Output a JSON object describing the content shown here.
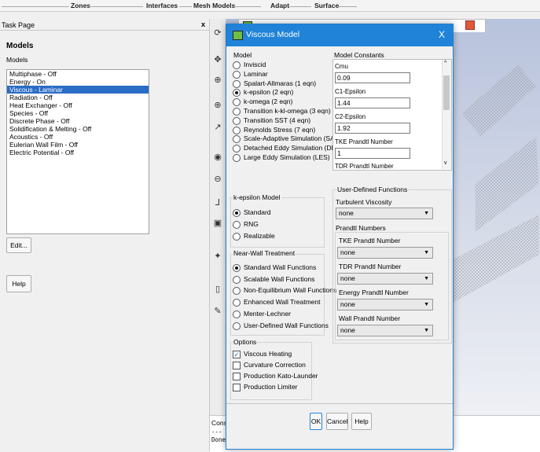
{
  "ribbon": {
    "zones": "Zones",
    "interfaces": "Interfaces",
    "mesh_models": "Mesh Models",
    "adapt": "Adapt",
    "surface": "Surface"
  },
  "task_page": {
    "header": "Task Page",
    "close": "x",
    "title": "Models",
    "subtitle": "Models",
    "models": [
      "Multiphase - Off",
      "Energy - On",
      "Viscous - Laminar",
      "Radiation - Off",
      "Heat Exchanger - Off",
      "Species - Off",
      "Discrete Phase - Off",
      "Solidification & Melting - Off",
      "Acoustics - Off",
      "Eulerian Wall Film - Off",
      "Electric Potential - Off"
    ],
    "selected_index": 2,
    "edit_label": "Edit...",
    "help_label": "Help"
  },
  "console": {
    "label": "Cons",
    "line1": "---",
    "line2": "Done."
  },
  "dialog": {
    "title": "Viscous Model",
    "close": "X",
    "model": {
      "caption": "Model",
      "options": [
        "Inviscid",
        "Laminar",
        "Spalart-Allmaras (1 eqn)",
        "k-epsilon (2 eqn)",
        "k-omega (2 eqn)",
        "Transition k-kl-omega (3 eqn)",
        "Transition SST (4 eqn)",
        "Reynolds Stress (7 eqn)",
        "Scale-Adaptive Simulation (SAS)",
        "Detached Eddy Simulation (DES)",
        "Large Eddy Simulation (LES)"
      ],
      "selected_index": 3
    },
    "kepsilon": {
      "caption": "k-epsilon Model",
      "options": [
        "Standard",
        "RNG",
        "Realizable"
      ],
      "selected_index": 0
    },
    "nearwall": {
      "caption": "Near-Wall Treatment",
      "options": [
        "Standard Wall Functions",
        "Scalable Wall Functions",
        "Non-Equilibrium Wall Functions",
        "Enhanced Wall Treatment",
        "Menter-Lechner",
        "User-Defined Wall Functions"
      ],
      "selected_index": 0
    },
    "options": {
      "caption": "Options",
      "items": [
        {
          "label": "Viscous Heating",
          "checked": true
        },
        {
          "label": "Curvature Correction",
          "checked": false
        },
        {
          "label": "Production Kato-Launder",
          "checked": false
        },
        {
          "label": "Production Limiter",
          "checked": false
        }
      ]
    },
    "constants": {
      "caption": "Model Constants",
      "items": [
        {
          "label": "Cmu",
          "value": "0.09"
        },
        {
          "label": "C1-Epsilon",
          "value": "1.44"
        },
        {
          "label": "C2-Epsilon",
          "value": "1.92"
        },
        {
          "label": "TKE Prandtl Number",
          "value": "1"
        }
      ],
      "cut_label": "TDR Prandtl Number"
    },
    "udf": {
      "caption": "User-Defined Functions",
      "turb_label": "Turbulent Viscosity",
      "turb_value": "none",
      "prandtl_caption": "Prandtl Numbers",
      "prandtl": [
        {
          "label": "TKE Prandtl Number",
          "value": "none"
        },
        {
          "label": "TDR Prandtl Number",
          "value": "none"
        },
        {
          "label": "Energy Prandtl Number",
          "value": "none"
        },
        {
          "label": "Wall Prandtl Number",
          "value": "none"
        }
      ]
    },
    "buttons": {
      "ok": "OK",
      "cancel": "Cancel",
      "help": "Help"
    }
  }
}
